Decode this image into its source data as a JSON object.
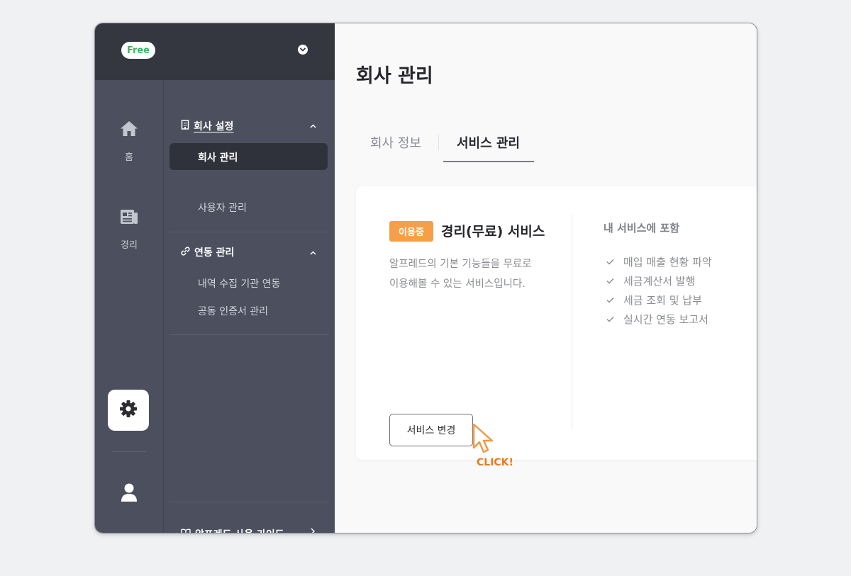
{
  "plan_badge": "Free",
  "rail": {
    "home_label": "홈",
    "bookkeeping_label": "경리",
    "settings_icon": "gear-icon",
    "user_icon": "user-icon"
  },
  "subnav": {
    "company_settings": {
      "label": "회사 설정",
      "items": [
        "회사 관리",
        "사용자 관리"
      ],
      "active": "회사 관리"
    },
    "integration": {
      "label": "연동 관리",
      "items": [
        "내역 수집 기관 연동",
        "공동 인증서 관리"
      ]
    },
    "guide_label": "알프레드 사용 가이드"
  },
  "main": {
    "page_title": "회사 관리",
    "tabs": [
      {
        "label": "회사 정보",
        "active": false
      },
      {
        "label": "서비스 관리",
        "active": true
      }
    ]
  },
  "service_card": {
    "status_badge": "이용중",
    "service_name": "경리(무료) 서비스",
    "description_line1": "알프레드의 기본 기능들을 무료로",
    "description_line2": "이용해볼 수 있는 서비스입니다.",
    "change_button": "서비스 변경",
    "included_title": "내 서비스에 포함",
    "features": [
      "매입 매출 현황 파악",
      "세금계산서 발행",
      "세금 조회 및 납부",
      "실시간 연동 보고서"
    ]
  },
  "annotation": {
    "click_label": "CLICK!"
  },
  "colors": {
    "sidebar_dark": "#343640",
    "sidebar": "#4c4f5d",
    "accent_orange": "#f5a048",
    "click_orange": "#e27e1f",
    "free_green": "#3fb464"
  }
}
